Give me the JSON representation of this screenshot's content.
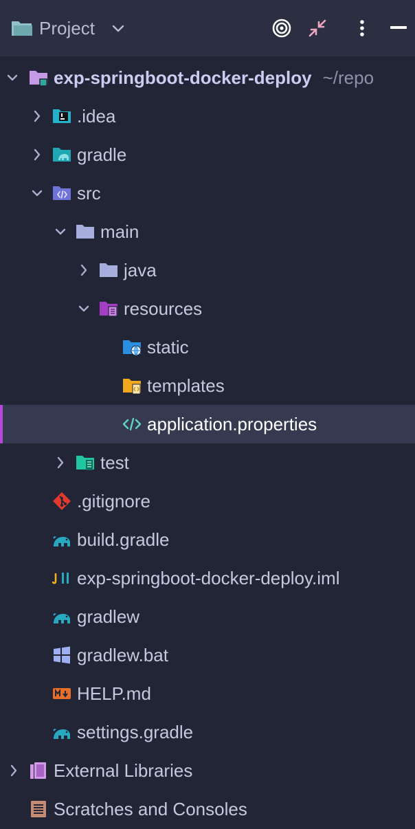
{
  "header": {
    "title": "Project"
  },
  "tree": {
    "root": {
      "name": "exp-springboot-docker-deploy",
      "path": "~/repo"
    },
    "idea": ".idea",
    "gradle_dir": "gradle",
    "src": "src",
    "main": "main",
    "java": "java",
    "resources": "resources",
    "static": "static",
    "templates": "templates",
    "app_props": "application.properties",
    "test": "test",
    "gitignore": ".gitignore",
    "build_gradle": "build.gradle",
    "iml": "exp-springboot-docker-deploy.iml",
    "gradlew": "gradlew",
    "gradlew_bat": "gradlew.bat",
    "help_md": "HELP.md",
    "settings_gradle": "settings.gradle",
    "external_libraries": "External Libraries",
    "scratches": "Scratches and Consoles"
  },
  "colors": {
    "background": "#222536",
    "header": "#2c2f42",
    "selection": "#363a51",
    "selection_accent": "#b04ad7"
  }
}
